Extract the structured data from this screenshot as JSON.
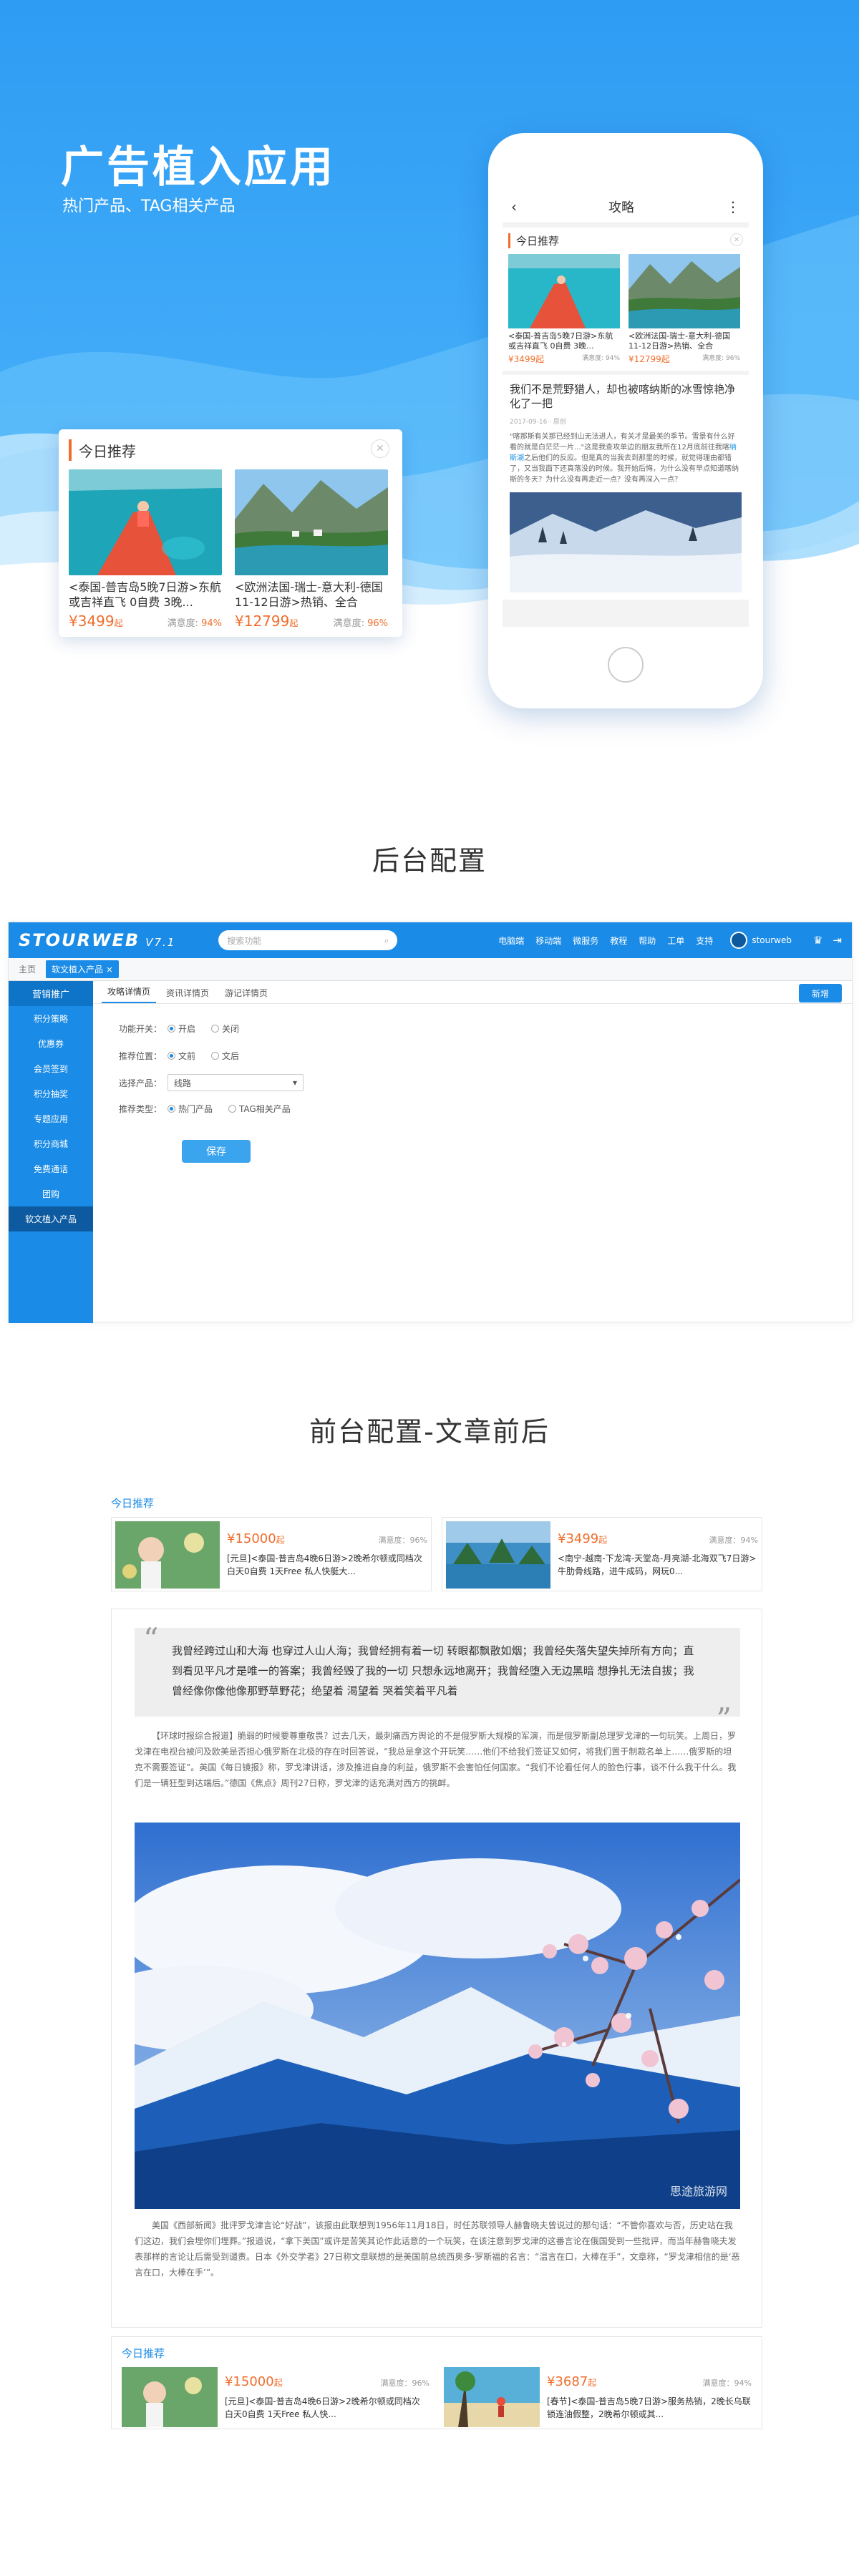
{
  "hero": {
    "title": "广告植入应用",
    "subtitle": "热门产品、TAG相关产品"
  },
  "promo": {
    "header": "今日推荐",
    "close_icon": "close-icon",
    "items": [
      {
        "title": "<泰国-普吉岛5晚7日游>东航或吉祥直飞 0自费 3晚...",
        "price": "3499",
        "unit": "起",
        "sat_label": "满意度:",
        "sat": "94%"
      },
      {
        "title": "<欧洲法国-瑞士-意大利-德国11-12日游>热销、全合",
        "price": "12799",
        "unit": "起",
        "sat_label": "满意度:",
        "sat": "96%"
      }
    ]
  },
  "phone": {
    "title": "攻略",
    "back_icon": "chevron-left-icon",
    "more_icon": "more-vertical-icon",
    "rec_header": "今日推荐",
    "items": [
      {
        "title": "<泰国-普吉岛5晚7日游>东航或吉祥直飞 0自费 3晚...",
        "price": "¥3499起",
        "sat": "满意度: 94%"
      },
      {
        "title": "<欧洲法国-瑞士-意大利-德国11-12日游>热销、全合",
        "price": "¥12799起",
        "sat": "满意度: 96%"
      }
    ],
    "article": {
      "title": "我们不是荒野猎人，却也被喀纳斯的冰雪惊艳净化了一把",
      "meta": "2017-09-16 · 原创",
      "text_a": "\"喀那斯有关那已经到山无法进人，有关才是最美的季节。雪景有什么好看的就是白茫茫一片...\"这是我查攻单边的朋友我所在12月底前往我喀",
      "link": "纳斯湖",
      "text_b": "之后他们的反应。但是真的当我去到那里的时候，就觉得理由都错了，又当我面下还真落没的时候。我开始后悔，为什么没有早点知道喀纳斯的冬天？为什么没有再走近一点？没有再深入一点？"
    }
  },
  "section_admin": "后台配置",
  "admin": {
    "logo": "STOURWEB",
    "version": "V7.1",
    "search_placeholder": "搜索功能",
    "nav": [
      "电脑端",
      "移动端",
      "微服务",
      "教程",
      "帮助",
      "工单",
      "支持"
    ],
    "user": "stourweb",
    "tabs": [
      "主页",
      "软文植入产品"
    ],
    "side": [
      "营销推广",
      "积分策略",
      "优惠券",
      "会员签到",
      "积分抽奖",
      "专题应用",
      "积分商城",
      "免费通话",
      "团购",
      "软文植入产品"
    ],
    "sub_tabs": [
      "攻略详情页",
      "资讯详情页",
      "游记详情页"
    ],
    "add_label": "新增",
    "form": {
      "switch_label": "功能开关：",
      "switch_on": "开启",
      "switch_off": "关闭",
      "pos_label": "推荐位置：",
      "pos_a": "文前",
      "pos_b": "文后",
      "product_label": "选择产品：",
      "product_value": "线路",
      "type_label": "推荐类型：",
      "type_a": "热门产品",
      "type_b": "TAG相关产品",
      "save": "保存"
    }
  },
  "section_front": "前台配置-文章前后",
  "article": {
    "rec_label": "今日推荐",
    "top_items": [
      {
        "price": "¥15000",
        "unit": "起",
        "sat": "满意度：96%",
        "desc": "[元旦]<泰国-普吉岛4晚6日游>2晚希尔顿或同档次 白天0自费 1天Free 私人快艇大..."
      },
      {
        "price": "¥3499",
        "unit": "起",
        "sat": "满意度：94%",
        "desc": "<南宁-越南-下龙湾-天堂岛-月亮湖-北海双飞7日游>牛肋骨线路，进牛成码，网玩0..."
      }
    ],
    "quote": "我曾经跨过山和大海 也穿过人山人海；我曾经拥有着一切 转眼都飘散如烟；我曾经失落失望失掉所有方向；直到看见平凡才是唯一的答案；我曾经毁了我的一切 只想永远地离开；我曾经堕入无边黑暗 想挣扎无法自拔；我曾经像你像他像那野草野花；绝望着 渴望着 哭着笑着平凡着",
    "para1": "【环球时报综合报道】脆弱的时候要尊重敬畏？过去几天，最刺痛西方舆论的不是俄罗斯大规模的军演，而是俄罗斯副总理罗戈津的一句玩笑。上周日，罗戈津在电视台被问及欧美是否担心俄罗斯在北极的存在时回答说，“我总是拿这个开玩笑……他们不给我们签证又如何，将我们置于制裁名单上……俄罗斯的坦克不需要签证”。英国《每日镜报》称，罗戈津讲话，涉及推进自身的利益，俄罗斯不会害怕任何国家。“我们不论看任何人的脸色行事，谈不什么我干什么。我们是一辆狂型到达端后。”德国《焦点》周刊27日称，罗戈津的话充满对西方的挑衅。",
    "watermark": "思途旅游网",
    "para2": "美国《西部新闻》批评罗戈津言论“好战”，该报由此联想到1956年11月18日，时任苏联领导人赫鲁晓夫曾说过的那句话：“不管你喜欢与否，历史站在我们这边，我们会埋你们埋葬。”报道说，“拿下美国”或许是苦笑其论作此话意的一个玩笑，在该注意到罗戈津的这番言论在俄国受到一些批评，而当年赫鲁晓夫发表那样的言论让后需受到谴责。日本《外交学者》27日称文章联想的是美国前总统西奥多·罗斯福的名言：“温言在口，大棒在手”，文章称，“罗戈津相信的是‘恶言在口，大棒在手’”。",
    "bottom_items": [
      {
        "price": "¥15000",
        "unit": "起",
        "sat": "满意度：96%",
        "desc": "[元旦]<泰国-普吉岛4晚6日游>2晚希尔顿或同档次 白天0自费 1天Free 私人快..."
      },
      {
        "price": "¥3687",
        "unit": "起",
        "sat": "满意度：94%",
        "desc": "[春节]<泰国-普吉岛5晚7日游>服务热销，2晚长乌联锁连油假整，2晚希尔顿或其..."
      }
    ]
  },
  "colors": {
    "primary": "#1a8be6",
    "accent": "#f06e2d"
  }
}
